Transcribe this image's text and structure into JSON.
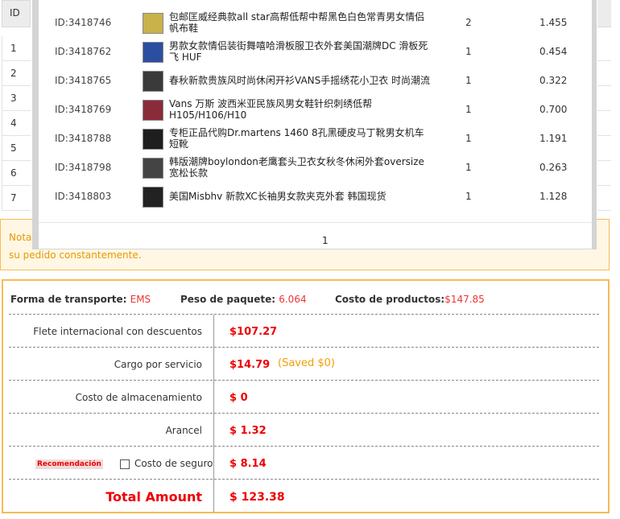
{
  "bg_table": {
    "id_header": "ID",
    "row_numbers": [
      "1",
      "2",
      "3",
      "4",
      "5",
      "6",
      "7"
    ]
  },
  "popup": {
    "items": [
      {
        "id": "ID:3418746",
        "name": "包邮匡威经典款all star高帮低帮中帮黑色白色常青男女情侣帆布鞋",
        "qty": "2",
        "weight": "1.455",
        "thumb_color": "#c9b24a"
      },
      {
        "id": "ID:3418762",
        "name": "男款女款情侣装街舞嘻哈滑板服卫衣外套美国潮牌DC 滑板死飞 HUF",
        "qty": "1",
        "weight": "0.454",
        "thumb_color": "#2c4ea0"
      },
      {
        "id": "ID:3418765",
        "name": "春秋新款贵族风时尚休闲开衫VANS手摇绣花小卫衣 时尚潮流",
        "qty": "1",
        "weight": "0.322",
        "thumb_color": "#3a3a3a"
      },
      {
        "id": "ID:3418769",
        "name": "Vans 万斯 波西米亚民族风男女鞋针织刺绣低帮H105/H106/H10",
        "qty": "1",
        "weight": "0.700",
        "thumb_color": "#8a2b3a"
      },
      {
        "id": "ID:3418788",
        "name": "专柜正品代购Dr.martens 1460 8孔黑硬皮马丁靴男女机车短靴",
        "qty": "1",
        "weight": "1.191",
        "thumb_color": "#1e1e1e"
      },
      {
        "id": "ID:3418798",
        "name": "韩版潮牌boylondon老鹰套头卫衣女秋冬休闲外套oversize宽松长款",
        "qty": "1",
        "weight": "0.263",
        "thumb_color": "#444444"
      },
      {
        "id": "ID:3418803",
        "name": "美国Misbhv 新款XC长袖男女款夹克外套 韩国现货",
        "qty": "1",
        "weight": "1.128",
        "thumb_color": "#222222"
      }
    ],
    "page": "1"
  },
  "nota": {
    "label": "Nota:",
    "line2": "su pedido constantemente."
  },
  "shipping": {
    "transport_label": "Forma de transporte:",
    "transport_value": "EMS",
    "weight_label": "Peso de paquete:",
    "weight_value": "6.064",
    "products_label": "Costo de productos:",
    "products_value": "$147.85",
    "rows": {
      "flete_label": "Flete internacional con descuentos",
      "flete_value": "$107.27",
      "cargo_label": "Cargo por servicio",
      "cargo_value": "$14.79",
      "cargo_saved": "(Saved $0)",
      "almacen_label": "Costo de almacenamiento",
      "almacen_value": "$ 0",
      "arancel_label": "Arancel",
      "arancel_value": "$ 1.32",
      "recomendacion": "Recomendación",
      "seguro_label": "Costo de seguro",
      "seguro_value": "$ 8.14",
      "seguro_checked": false,
      "total_label": "Total Amount",
      "total_value": "$ 123.38"
    },
    "colors": {
      "accent_red": "#e00000",
      "border_orange": "#f6bc55",
      "saved_orange": "#f19f00"
    }
  }
}
